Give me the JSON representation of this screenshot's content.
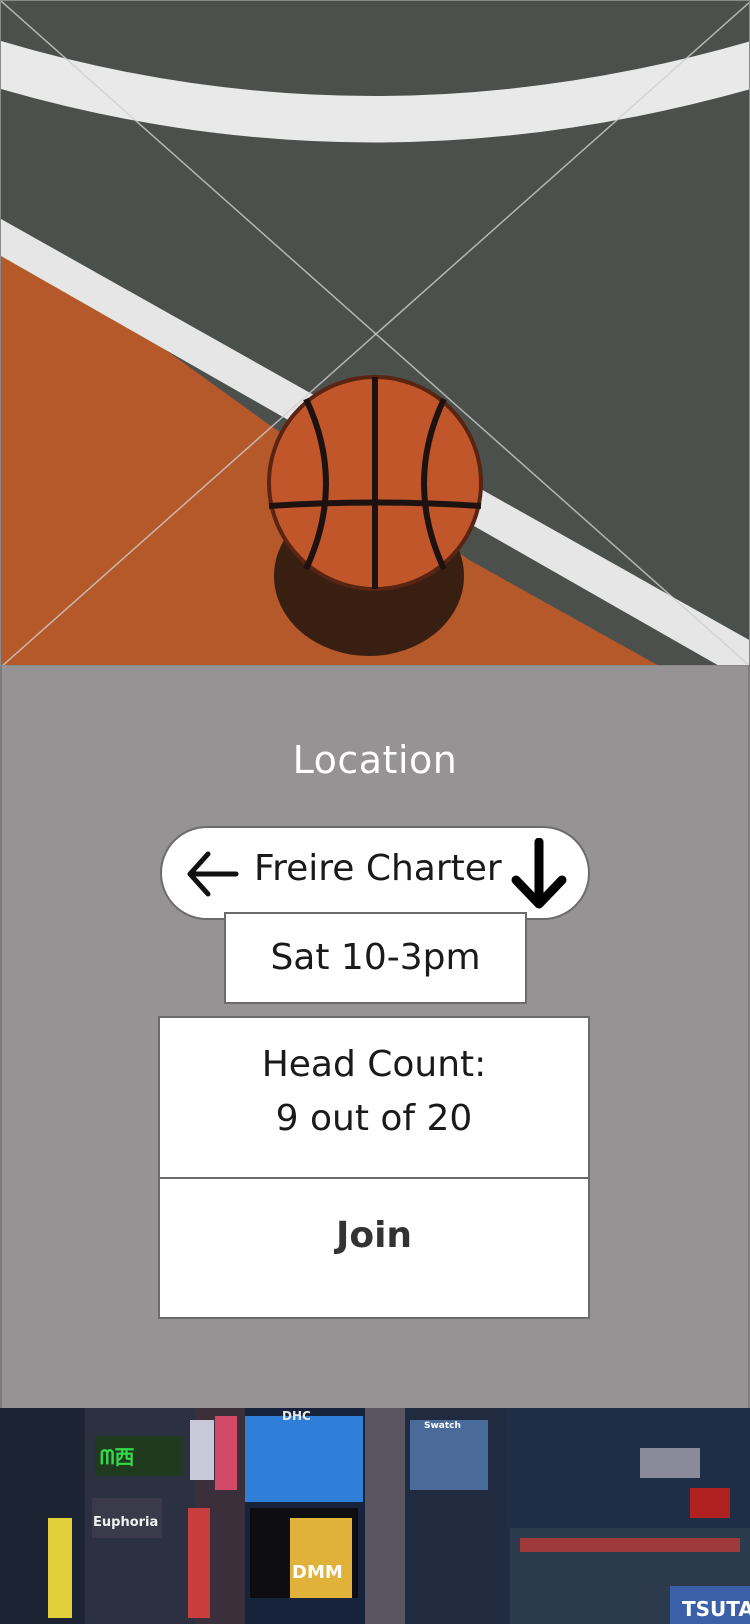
{
  "hero": {
    "image": "basketball-court-photo"
  },
  "location": {
    "title": "Location",
    "name": "Freire Charter",
    "back_icon": "arrow-left-icon",
    "dropdown_icon": "arrow-down-icon"
  },
  "schedule": {
    "time": "Sat 10-3pm"
  },
  "head_count": {
    "label": "Head Count:",
    "value": "9 out of 20"
  },
  "actions": {
    "join_label": "Join"
  },
  "footer_photo": {
    "image": "city-street-photo",
    "signs": [
      "DHC",
      "Euphoria",
      "Swatch",
      "DMM",
      "TSUTA"
    ]
  },
  "colors": {
    "panel_bg": "#959393",
    "box_bg": "#ffffff",
    "title_text": "#ffffff",
    "court_gray": "#4a4f4c",
    "court_orange": "#b5592b",
    "ball_orange": "#c0562a"
  }
}
